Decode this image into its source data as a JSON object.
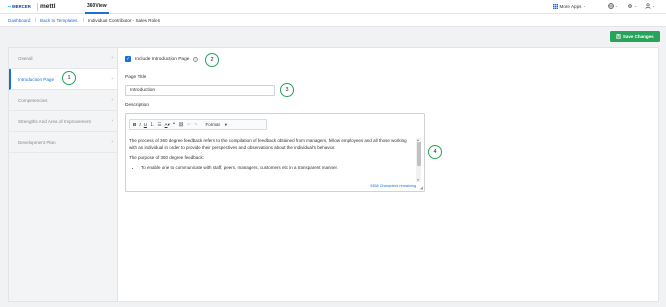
{
  "header": {
    "brand_mercer": "MERCER",
    "brand_mettl": "mettl",
    "app_tab": "360View",
    "more_apps": "More Apps",
    "colors": {
      "accent": "#1d6fd8",
      "success": "#27a35a",
      "brand": "#0b3d91"
    }
  },
  "breadcrumb": {
    "items": [
      "Dashboard",
      "Back to Templates",
      "Individual Contributor - Sales Roles"
    ],
    "separator": "|"
  },
  "toolbar": {
    "save_label": "Save Changes"
  },
  "sidebar": {
    "items": [
      {
        "label": "Overall",
        "active": false
      },
      {
        "label": "Introduction Page",
        "active": true
      },
      {
        "label": "Competencies",
        "active": false
      },
      {
        "label": "Strengths And Area of Improvement",
        "active": false
      },
      {
        "label": "Development Plan",
        "active": false
      }
    ]
  },
  "form": {
    "include_intro_label": "Include Introduction Page",
    "include_intro_checked": true,
    "page_title_label": "Page Title",
    "page_title_value": "Introduction",
    "description_label": "Description",
    "format_label": "Format",
    "description_paragraphs": [
      "The process of 360 degree feedback refers to the compilation of feedback obtained from managers, fellow employees and all those working with an individual in order to provide their perspectives and observations about the individual's behavior.",
      "The purpose of 360 degree feedback:"
    ],
    "description_bullets": [
      "To enable one to communicate with staff, peers, managers, customers etc in a transparent manner."
    ],
    "chars_remaining": "9358 Characters remaining"
  },
  "annotations": [
    "1",
    "2",
    "3",
    "4"
  ],
  "icons": [
    "apps-grid-icon",
    "globe-icon",
    "settings-icon",
    "user-icon",
    "save-icon",
    "help-icon"
  ]
}
